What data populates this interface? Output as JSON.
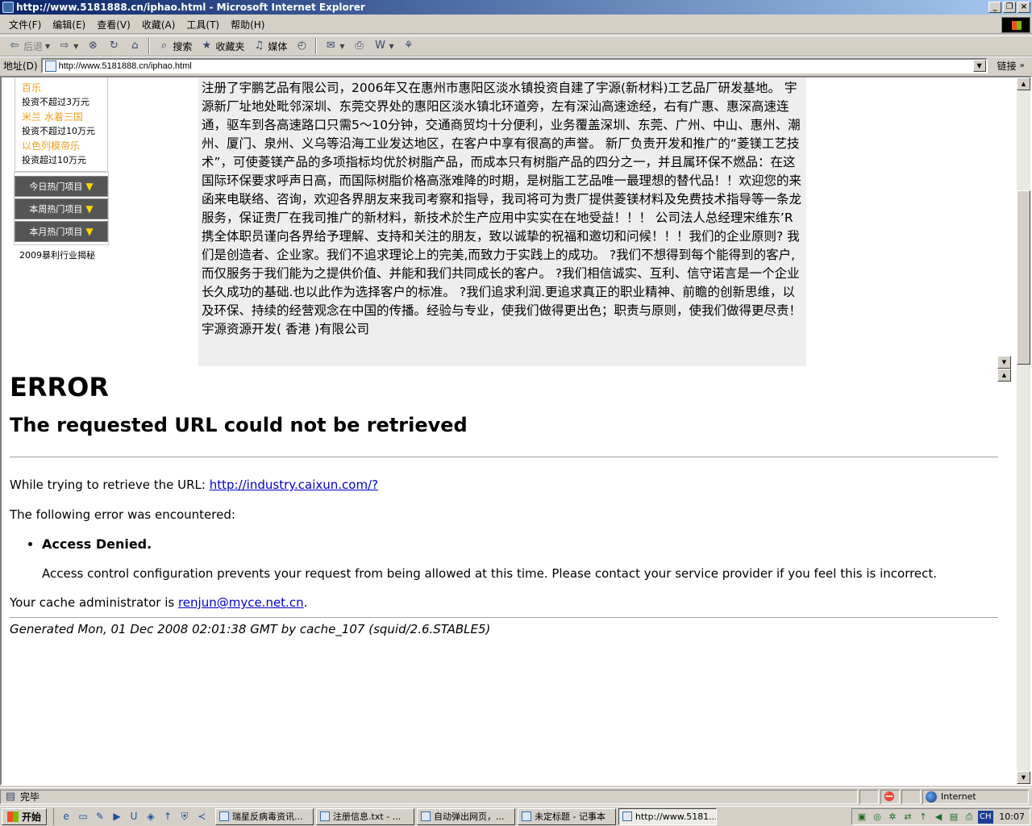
{
  "window": {
    "title": "http://www.5181888.cn/iphao.html - Microsoft Internet Explorer",
    "minimize": "0",
    "restore": "1",
    "close": "r"
  },
  "menu": [
    "文件(F)",
    "编辑(E)",
    "查看(V)",
    "收藏(A)",
    "工具(T)",
    "帮助(H)"
  ],
  "toolbar": {
    "back": "后退",
    "search": "搜索",
    "favorites": "收藏夹",
    "media": "媒体"
  },
  "address": {
    "label": "地址(D)",
    "url": "http://www.5181888.cn/iphao.html",
    "links": "链接"
  },
  "left_panel": {
    "investments": [
      {
        "name": "百乐",
        "range": "投资不超过3万元"
      },
      {
        "name": "米兰  水着三国",
        "range": "投资不超过10万元"
      },
      {
        "name": "以色列模帝乐",
        "range": "投资超过10万元"
      }
    ],
    "hot": [
      "今日热门项目",
      "本周热门项目",
      "本月热门项目"
    ],
    "hot_arrow": "▼",
    "secret": "2009暴利行业揭秘"
  },
  "company_text": "注册了宇鹏艺品有限公司，2006年又在惠州市惠阳区淡水镇投资自建了宇源(新材料)工艺品厂研发基地。 宇源新厂址地处毗邻深圳、东莞交界处的惠阳区淡水镇北环道旁，左有深汕高速途经，右有广惠、惠深高速连通，驱车到各高速路口只需5～10分钟，交通商贸均十分便利，业务覆盖深圳、东莞、广州、中山、惠州、潮州、厦门、泉州、义乌等沿海工业发达地区，在客户中享有很高的声誉。 新厂负责开发和推广的“菱镁工艺技术”，可使菱镁产品的多项指标均优於树脂产品，而成本只有树脂产品的四分之一，并且属环保不燃品：在这国际环保要求呼声日高，而国际树脂价格高涨难降的时期，是树脂工艺品唯一最理想的替代品！！欢迎您的来函来电联络、咨询，欢迎各界朋友来我司考察和指导，我司将可为贵厂提供菱镁材料及免费技术指导等一条龙服务，保证贵厂在我司推广的新材料，新技术於生产应用中实实在在地受益！！！ 公司法人总经理宋维东’R携全体职员谨向各界给予理解、支持和关注的朋友，致以诚挚的祝福和邀切和问候！！！我们的企业原则? 我们是创造者、企业家。我们不追求理论上的完美,而致力于实践上的成功。 ?我们不想得到每个能得到的客户,而仅服务于我们能为之提供价值、并能和我们共同成长的客户。 ?我们相信诚实、互利、信守诺言是一个企业长久成功的基础.也以此作为选择客户的标准。 ?我们追求利润.更追求真正的职业精神、前瞻的创新思维，以及环保、持续的经营观念在中国的传播。经验与专业，使我们做得更出色；职责与原则，使我们做得更尽责！宇源资源开发( 香港 )有限公司",
  "error": {
    "h1": "ERROR",
    "h2": "The requested URL could not be retrieved",
    "trying": "While trying to retrieve the URL: ",
    "url": "http://industry.caixun.com/?",
    "encountered": "The following error was encountered:",
    "denied": "Access Denied.",
    "detail": "Access control configuration prevents your request from being allowed at this time. Please contact your service provider if you feel this is incorrect.",
    "admin_prefix": "Your cache administrator is ",
    "admin_email": "renjun@myce.net.cn",
    "admin_suffix": ".",
    "generated": "Generated Mon, 01 Dec 2008 02:01:38 GMT by cache_107 (squid/2.6.STABLE5)"
  },
  "status": {
    "text": "完毕",
    "zone": "Internet"
  },
  "taskbar": {
    "start": "开始",
    "tasks": [
      {
        "label": "瑞星反病毒资讯...",
        "active": false
      },
      {
        "label": "注册信息.txt - ...",
        "active": false
      },
      {
        "label": "自动弹出网页，...",
        "active": false
      },
      {
        "label": "未定标题 - 记事本",
        "active": false
      },
      {
        "label": "http://www.5181...",
        "active": true
      }
    ],
    "lang": "CH",
    "clock": "10:07"
  }
}
